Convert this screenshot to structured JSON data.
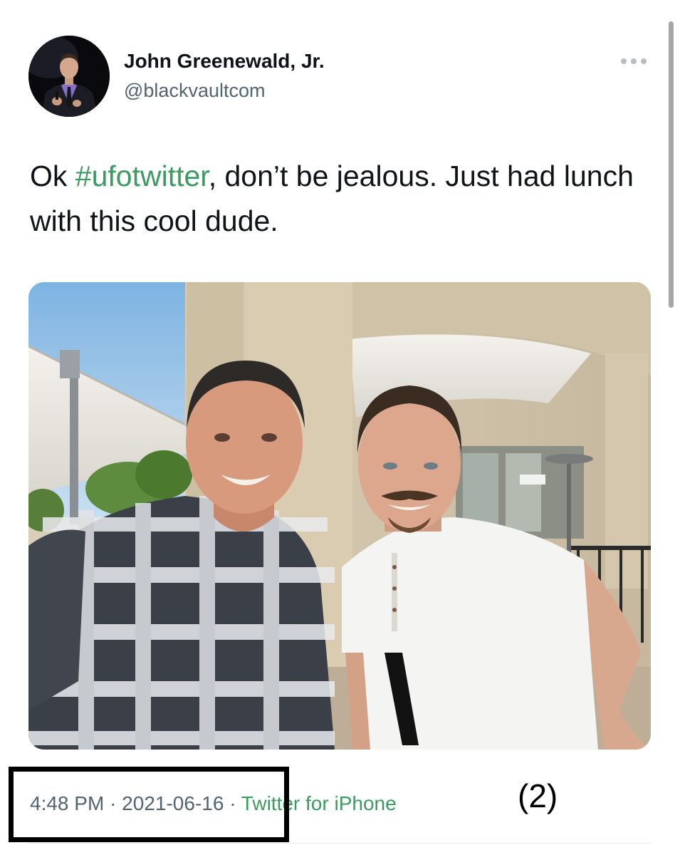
{
  "tweet": {
    "author": {
      "display_name": "John Greenewald, Jr.",
      "handle": "@blackvaultcom",
      "avatar": "avatar-photo"
    },
    "more_icon": "more-dots-icon",
    "text": {
      "before": "Ok ",
      "hashtag": "#ufotwitter",
      "after": ", don’t be jealous. Just had lunch with this cool dude."
    },
    "photo": "selfie-photo",
    "time": "4:48 PM",
    "separator": "·",
    "date": "2021-06-16",
    "source": "Twitter for iPhone"
  },
  "annotation": {
    "label": "(2)"
  },
  "colors": {
    "hashtag": "#3c9b60",
    "secondary_text": "#536471",
    "primary_text": "#0f1419"
  }
}
